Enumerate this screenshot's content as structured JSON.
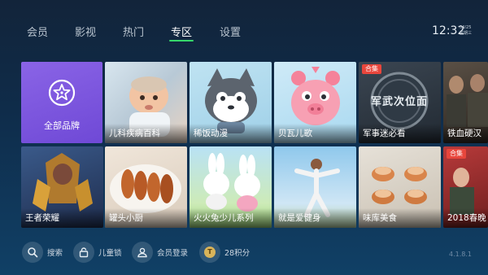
{
  "nav": {
    "tabs": [
      {
        "label": "会员",
        "active": false
      },
      {
        "label": "影视",
        "active": false
      },
      {
        "label": "热门",
        "active": false
      },
      {
        "label": "专区",
        "active": true
      },
      {
        "label": "设置",
        "active": false
      }
    ],
    "accent_color": "#36d86a"
  },
  "clock": {
    "time": "12:32",
    "date": "04/25",
    "weekday": "星期三"
  },
  "brand_tile": {
    "label": "全部品牌",
    "icon": "star-icon",
    "color": "#7a54de"
  },
  "row1": [
    {
      "label": "儿科疾病百科",
      "badge": ""
    },
    {
      "label": "稀饭动漫",
      "badge": ""
    },
    {
      "label": "贝瓦儿歌",
      "badge": ""
    },
    {
      "label": "军事迷必看",
      "badge": "合集",
      "art_text": "军武次位面"
    },
    {
      "label": "铁血硬汉",
      "badge": ""
    }
  ],
  "row2": [
    {
      "label": "王者荣耀",
      "badge": ""
    },
    {
      "label": "罐头小厨",
      "badge": ""
    },
    {
      "label": "火火兔少儿系列",
      "badge": ""
    },
    {
      "label": "就是爱健身",
      "badge": ""
    },
    {
      "label": "味库美食",
      "badge": ""
    },
    {
      "label": "2018春晚",
      "badge": "合集"
    }
  ],
  "bottom_bar": [
    {
      "label": "搜索",
      "icon": "search-icon"
    },
    {
      "label": "儿童锁",
      "icon": "lock-icon"
    },
    {
      "label": "会员登录",
      "icon": "user-icon"
    },
    {
      "label": "28积分",
      "icon": "coin-icon",
      "icon_text": "T"
    }
  ],
  "version": "4.1.8.1"
}
